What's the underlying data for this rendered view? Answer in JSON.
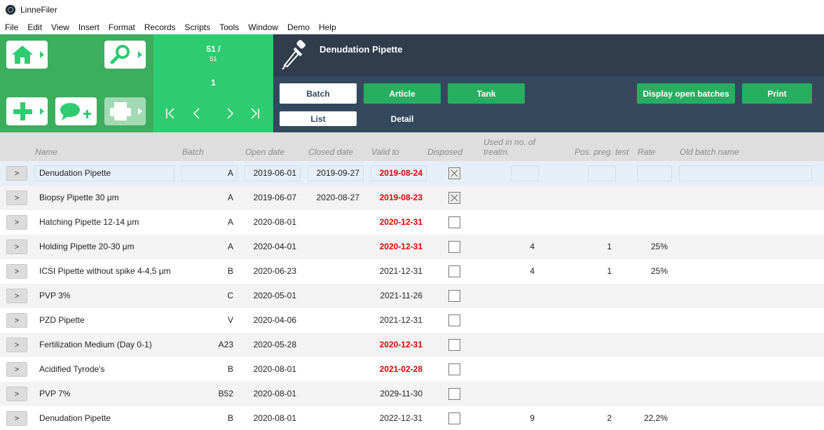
{
  "window": {
    "title": "LinneFiler"
  },
  "menu": [
    "File",
    "Edit",
    "View",
    "Insert",
    "Format",
    "Records",
    "Scripts",
    "Tools",
    "Window",
    "Demo",
    "Help"
  ],
  "nav": {
    "record_count_line": "51 /",
    "record_total": "51",
    "current_record": "1",
    "first_symbol": "|<",
    "prev_symbol": "<",
    "next_symbol": ">",
    "last_symbol": ">|"
  },
  "header": {
    "record_title": "Denudation Pipette",
    "tabs": {
      "batch": "Batch",
      "article": "Article",
      "tank": "Tank"
    },
    "actions": {
      "display_open_batches": "Display open batches",
      "print": "Print"
    },
    "subtabs": {
      "list": "List",
      "detail": "Detail"
    }
  },
  "columns": {
    "name": "Name",
    "batch": "Batch",
    "open_date": "Open date",
    "closed_date": "Closed date",
    "valid_to": "Valid to",
    "disposed": "Disposed",
    "used_line1": "Used in no. of",
    "used_line2": "treatm.",
    "pos_preg_test": "Pos. preg. test",
    "rate": "Rate",
    "old_batch_name": "Old batch name"
  },
  "goto_label": ">",
  "rows": [
    {
      "name": "Denudation Pipette",
      "batch": "A",
      "open": "2019-06-01",
      "closed": "2019-09-27",
      "valid": "2019-08-24",
      "valid_red": true,
      "disposed": true,
      "used": "",
      "pos": "",
      "rate": "",
      "selected": true
    },
    {
      "name": "Biopsy Pipette 30 μm",
      "batch": "A",
      "open": "2019-06-07",
      "closed": "2020-08-27",
      "valid": "2019-08-23",
      "valid_red": true,
      "disposed": true,
      "used": "",
      "pos": "",
      "rate": ""
    },
    {
      "name": "Hatching Pipette 12-14 μm",
      "batch": "A",
      "open": "2020-08-01",
      "closed": "",
      "valid": "2020-12-31",
      "valid_red": true,
      "disposed": false,
      "used": "",
      "pos": "",
      "rate": ""
    },
    {
      "name": "Holding Pipette 20-30 μm",
      "batch": "A",
      "open": "2020-04-01",
      "closed": "",
      "valid": "2020-12-31",
      "valid_red": true,
      "disposed": false,
      "used": "4",
      "pos": "1",
      "rate": "25%"
    },
    {
      "name": "ICSI Pipette without spike 4-4,5 μm",
      "batch": "B",
      "open": "2020-06-23",
      "closed": "",
      "valid": "2021-12-31",
      "valid_red": false,
      "disposed": false,
      "used": "4",
      "pos": "1",
      "rate": "25%"
    },
    {
      "name": "PVP 3%",
      "batch": "C",
      "open": "2020-05-01",
      "closed": "",
      "valid": "2021-11-26",
      "valid_red": false,
      "disposed": false,
      "used": "",
      "pos": "",
      "rate": ""
    },
    {
      "name": "PZD Pipette",
      "batch": "V",
      "open": "2020-04-06",
      "closed": "",
      "valid": "2021-12-31",
      "valid_red": false,
      "disposed": false,
      "used": "",
      "pos": "",
      "rate": ""
    },
    {
      "name": "Fertilization Medium (Day 0-1)",
      "batch": "A23",
      "open": "2020-05-28",
      "closed": "",
      "valid": "2020-12-31",
      "valid_red": true,
      "disposed": false,
      "used": "",
      "pos": "",
      "rate": ""
    },
    {
      "name": "Acidified Tyrode's",
      "batch": "B",
      "open": "2020-08-01",
      "closed": "",
      "valid": "2021-02-28",
      "valid_red": true,
      "disposed": false,
      "used": "",
      "pos": "",
      "rate": ""
    },
    {
      "name": "PVP 7%",
      "batch": "B52",
      "open": "2020-08-01",
      "closed": "",
      "valid": "2029-11-30",
      "valid_red": false,
      "disposed": false,
      "used": "",
      "pos": "",
      "rate": ""
    },
    {
      "name": "Denudation Pipette",
      "batch": "B",
      "open": "2020-08-01",
      "closed": "",
      "valid": "2022-12-31",
      "valid_red": false,
      "disposed": false,
      "used": "9",
      "pos": "2",
      "rate": "22,2%"
    }
  ]
}
